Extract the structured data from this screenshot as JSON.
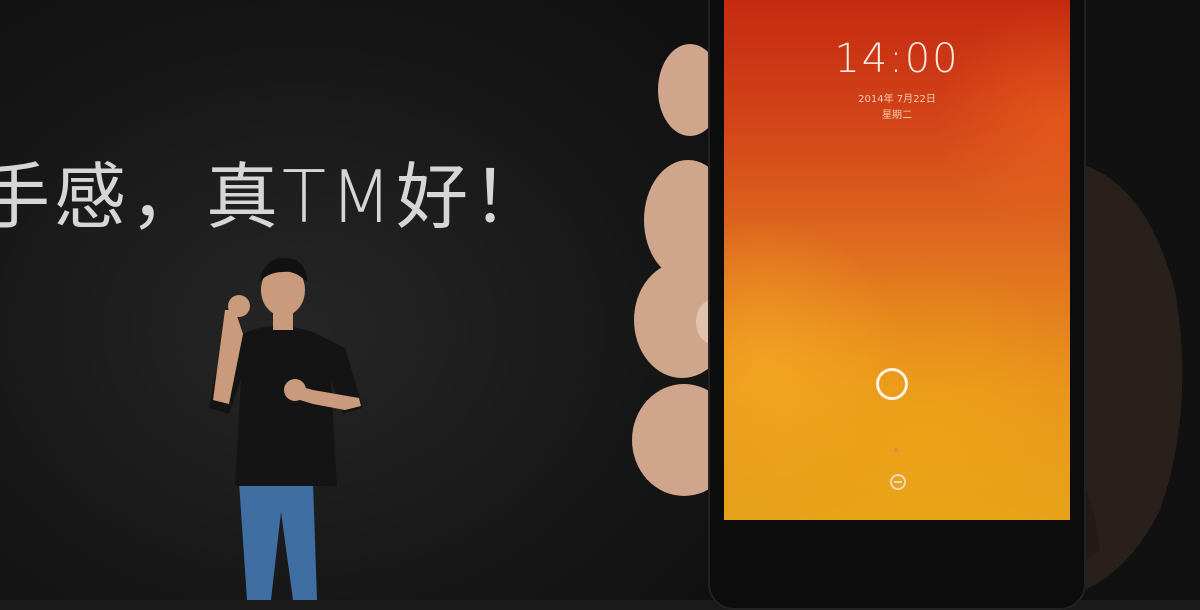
{
  "slide": {
    "headline": "手感，真TM好！"
  },
  "phone": {
    "time": "14:00",
    "date": "2014年 7月22日",
    "weekday": "星期二"
  },
  "colors": {
    "background": "#161616",
    "headline": "#d6d6d6",
    "screen_top": "#c42a10",
    "screen_bottom": "#e6a21a"
  }
}
